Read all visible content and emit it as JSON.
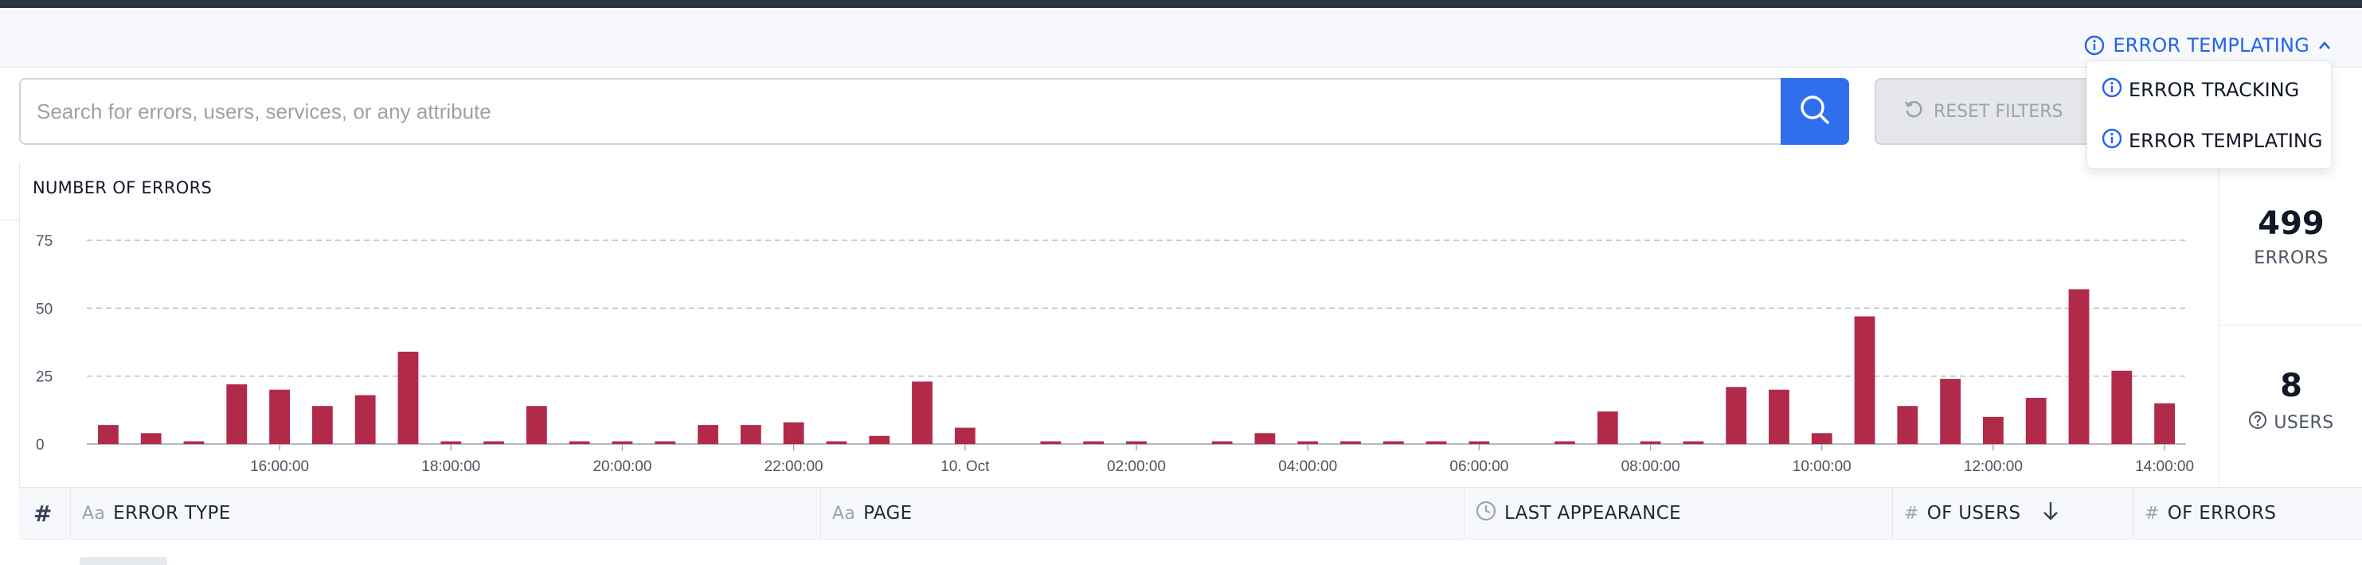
{
  "header": {
    "templating_toggle_label": "ERROR TEMPLATING",
    "dropdown": [
      {
        "label": "ERROR TRACKING"
      },
      {
        "label": "ERROR TEMPLATING"
      }
    ]
  },
  "search": {
    "placeholder": "Search for errors, users, services, or any attribute",
    "value": "",
    "reset_label": "RESET FILTERS"
  },
  "colors": {
    "accent": "#2f6fed",
    "bar": "#b22a4a"
  },
  "chart_data": {
    "type": "bar",
    "title": "NUMBER OF ERRORS",
    "ylim": [
      0,
      75
    ],
    "yticks": [
      "0",
      "25",
      "50",
      "75"
    ],
    "xticks": [
      {
        "label": "16:00:00",
        "index": 4
      },
      {
        "label": "18:00:00",
        "index": 8
      },
      {
        "label": "20:00:00",
        "index": 12
      },
      {
        "label": "22:00:00",
        "index": 16
      },
      {
        "label": "10. Oct",
        "index": 20
      },
      {
        "label": "02:00:00",
        "index": 24
      },
      {
        "label": "04:00:00",
        "index": 28
      },
      {
        "label": "06:00:00",
        "index": 32
      },
      {
        "label": "08:00:00",
        "index": 36
      },
      {
        "label": "10:00:00",
        "index": 40
      },
      {
        "label": "12:00:00",
        "index": 44
      },
      {
        "label": "14:00:00",
        "index": 48
      }
    ],
    "values": [
      7,
      4,
      1,
      22,
      20,
      14,
      18,
      34,
      1,
      1,
      14,
      1,
      1,
      1,
      7,
      7,
      8,
      1,
      3,
      23,
      6,
      0,
      1,
      1,
      1,
      0,
      1,
      4,
      1,
      1,
      1,
      1,
      1,
      0,
      1,
      12,
      1,
      1,
      21,
      20,
      4,
      47,
      14,
      24,
      10,
      17,
      57,
      27,
      15
    ],
    "grid": true,
    "legend": "none"
  },
  "stats": {
    "errors_value": "499",
    "errors_label": "ERRORS",
    "users_value": "8",
    "users_label": "USERS"
  },
  "table": {
    "columns": [
      {
        "icon": "#",
        "label": ""
      },
      {
        "icon": "Aa",
        "label": "ERROR TYPE"
      },
      {
        "icon": "Aa",
        "label": "PAGE"
      },
      {
        "icon": "clock",
        "label": "LAST APPEARANCE"
      },
      {
        "icon": "#",
        "label": "OF USERS"
      },
      {
        "icon": "#",
        "label": "OF ERRORS"
      }
    ]
  }
}
